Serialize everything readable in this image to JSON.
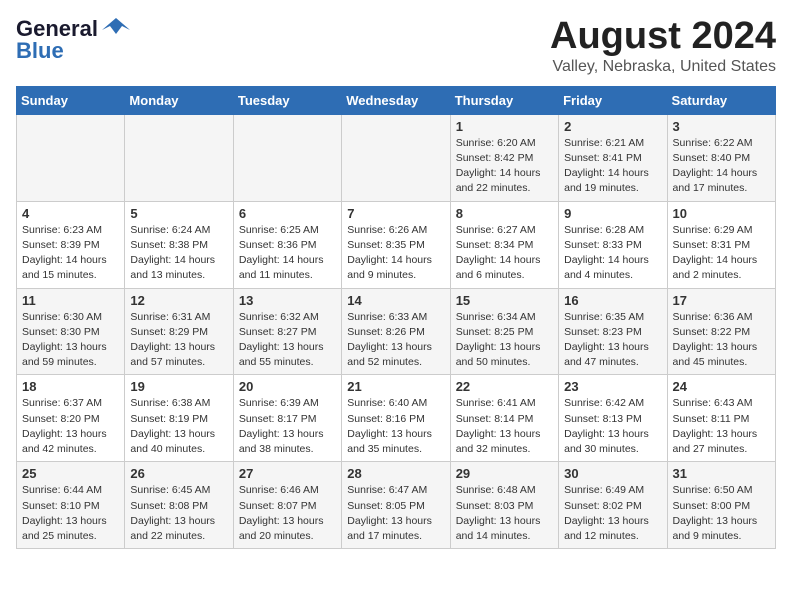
{
  "logo": {
    "line1": "General",
    "line2": "Blue"
  },
  "calendar": {
    "title": "August 2024",
    "subtitle": "Valley, Nebraska, United States"
  },
  "headers": [
    "Sunday",
    "Monday",
    "Tuesday",
    "Wednesday",
    "Thursday",
    "Friday",
    "Saturday"
  ],
  "weeks": [
    [
      {
        "day": "",
        "detail": ""
      },
      {
        "day": "",
        "detail": ""
      },
      {
        "day": "",
        "detail": ""
      },
      {
        "day": "",
        "detail": ""
      },
      {
        "day": "1",
        "detail": "Sunrise: 6:20 AM\nSunset: 8:42 PM\nDaylight: 14 hours\nand 22 minutes."
      },
      {
        "day": "2",
        "detail": "Sunrise: 6:21 AM\nSunset: 8:41 PM\nDaylight: 14 hours\nand 19 minutes."
      },
      {
        "day": "3",
        "detail": "Sunrise: 6:22 AM\nSunset: 8:40 PM\nDaylight: 14 hours\nand 17 minutes."
      }
    ],
    [
      {
        "day": "4",
        "detail": "Sunrise: 6:23 AM\nSunset: 8:39 PM\nDaylight: 14 hours\nand 15 minutes."
      },
      {
        "day": "5",
        "detail": "Sunrise: 6:24 AM\nSunset: 8:38 PM\nDaylight: 14 hours\nand 13 minutes."
      },
      {
        "day": "6",
        "detail": "Sunrise: 6:25 AM\nSunset: 8:36 PM\nDaylight: 14 hours\nand 11 minutes."
      },
      {
        "day": "7",
        "detail": "Sunrise: 6:26 AM\nSunset: 8:35 PM\nDaylight: 14 hours\nand 9 minutes."
      },
      {
        "day": "8",
        "detail": "Sunrise: 6:27 AM\nSunset: 8:34 PM\nDaylight: 14 hours\nand 6 minutes."
      },
      {
        "day": "9",
        "detail": "Sunrise: 6:28 AM\nSunset: 8:33 PM\nDaylight: 14 hours\nand 4 minutes."
      },
      {
        "day": "10",
        "detail": "Sunrise: 6:29 AM\nSunset: 8:31 PM\nDaylight: 14 hours\nand 2 minutes."
      }
    ],
    [
      {
        "day": "11",
        "detail": "Sunrise: 6:30 AM\nSunset: 8:30 PM\nDaylight: 13 hours\nand 59 minutes."
      },
      {
        "day": "12",
        "detail": "Sunrise: 6:31 AM\nSunset: 8:29 PM\nDaylight: 13 hours\nand 57 minutes."
      },
      {
        "day": "13",
        "detail": "Sunrise: 6:32 AM\nSunset: 8:27 PM\nDaylight: 13 hours\nand 55 minutes."
      },
      {
        "day": "14",
        "detail": "Sunrise: 6:33 AM\nSunset: 8:26 PM\nDaylight: 13 hours\nand 52 minutes."
      },
      {
        "day": "15",
        "detail": "Sunrise: 6:34 AM\nSunset: 8:25 PM\nDaylight: 13 hours\nand 50 minutes."
      },
      {
        "day": "16",
        "detail": "Sunrise: 6:35 AM\nSunset: 8:23 PM\nDaylight: 13 hours\nand 47 minutes."
      },
      {
        "day": "17",
        "detail": "Sunrise: 6:36 AM\nSunset: 8:22 PM\nDaylight: 13 hours\nand 45 minutes."
      }
    ],
    [
      {
        "day": "18",
        "detail": "Sunrise: 6:37 AM\nSunset: 8:20 PM\nDaylight: 13 hours\nand 42 minutes."
      },
      {
        "day": "19",
        "detail": "Sunrise: 6:38 AM\nSunset: 8:19 PM\nDaylight: 13 hours\nand 40 minutes."
      },
      {
        "day": "20",
        "detail": "Sunrise: 6:39 AM\nSunset: 8:17 PM\nDaylight: 13 hours\nand 38 minutes."
      },
      {
        "day": "21",
        "detail": "Sunrise: 6:40 AM\nSunset: 8:16 PM\nDaylight: 13 hours\nand 35 minutes."
      },
      {
        "day": "22",
        "detail": "Sunrise: 6:41 AM\nSunset: 8:14 PM\nDaylight: 13 hours\nand 32 minutes."
      },
      {
        "day": "23",
        "detail": "Sunrise: 6:42 AM\nSunset: 8:13 PM\nDaylight: 13 hours\nand 30 minutes."
      },
      {
        "day": "24",
        "detail": "Sunrise: 6:43 AM\nSunset: 8:11 PM\nDaylight: 13 hours\nand 27 minutes."
      }
    ],
    [
      {
        "day": "25",
        "detail": "Sunrise: 6:44 AM\nSunset: 8:10 PM\nDaylight: 13 hours\nand 25 minutes."
      },
      {
        "day": "26",
        "detail": "Sunrise: 6:45 AM\nSunset: 8:08 PM\nDaylight: 13 hours\nand 22 minutes."
      },
      {
        "day": "27",
        "detail": "Sunrise: 6:46 AM\nSunset: 8:07 PM\nDaylight: 13 hours\nand 20 minutes."
      },
      {
        "day": "28",
        "detail": "Sunrise: 6:47 AM\nSunset: 8:05 PM\nDaylight: 13 hours\nand 17 minutes."
      },
      {
        "day": "29",
        "detail": "Sunrise: 6:48 AM\nSunset: 8:03 PM\nDaylight: 13 hours\nand 14 minutes."
      },
      {
        "day": "30",
        "detail": "Sunrise: 6:49 AM\nSunset: 8:02 PM\nDaylight: 13 hours\nand 12 minutes."
      },
      {
        "day": "31",
        "detail": "Sunrise: 6:50 AM\nSunset: 8:00 PM\nDaylight: 13 hours\nand 9 minutes."
      }
    ]
  ]
}
